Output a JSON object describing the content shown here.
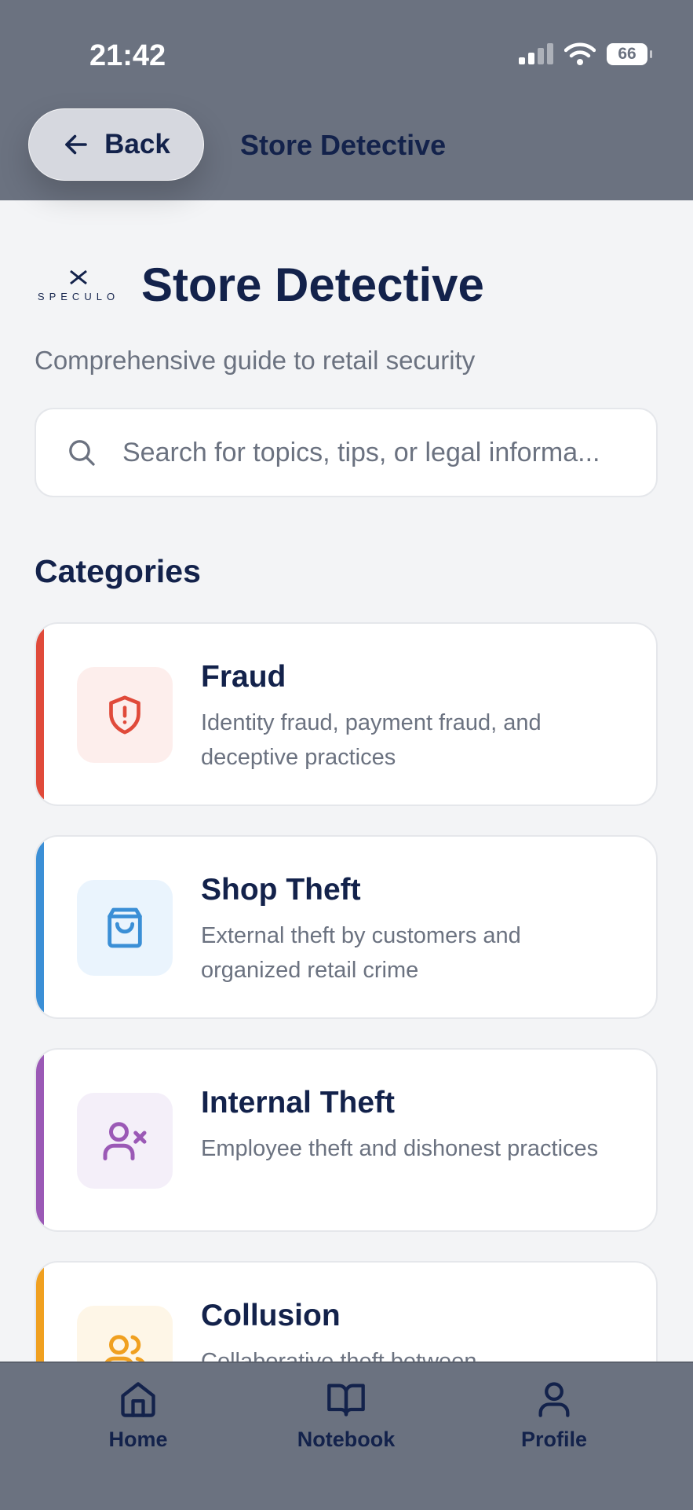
{
  "status_bar": {
    "time": "21:42",
    "battery": "66"
  },
  "header": {
    "back_label": "Back",
    "title": "Store Detective"
  },
  "brand": {
    "logo_text": "SPECULO"
  },
  "page": {
    "title": "Store Detective",
    "subtitle": "Comprehensive guide to retail security"
  },
  "search": {
    "placeholder": "Search for topics, tips, or legal informa..."
  },
  "categories": {
    "heading": "Categories",
    "items": [
      {
        "title": "Fraud",
        "description": "Identity fraud, payment fraud, and deceptive practices",
        "icon": "shield-alert-icon",
        "accent": "#e04a3a",
        "icon_bg": "#fdeeec"
      },
      {
        "title": "Shop Theft",
        "description": "External theft by customers and organized retail crime",
        "icon": "shopping-bag-icon",
        "accent": "#3b8fd6",
        "icon_bg": "#eaf4fd"
      },
      {
        "title": "Internal Theft",
        "description": "Employee theft and dishonest practices",
        "icon": "user-x-icon",
        "accent": "#9b59b6",
        "icon_bg": "#f4eff9"
      },
      {
        "title": "Collusion",
        "description": "Collaborative theft between",
        "icon": "users-icon",
        "accent": "#f0a020",
        "icon_bg": "#fef6e7"
      }
    ]
  },
  "nav": {
    "items": [
      {
        "label": "Home",
        "icon": "home-icon"
      },
      {
        "label": "Notebook",
        "icon": "book-icon"
      },
      {
        "label": "Profile",
        "icon": "user-icon"
      }
    ]
  },
  "colors": {
    "header_bg": "#6b7280",
    "text_primary": "#13224b",
    "text_muted": "#6b7280",
    "page_bg": "#f3f4f6"
  }
}
